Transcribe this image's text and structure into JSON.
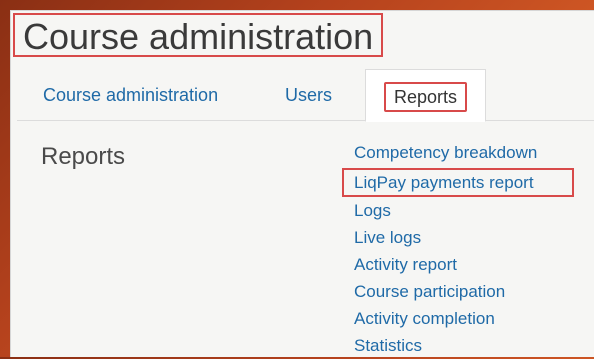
{
  "page": {
    "title": "Course administration"
  },
  "tabs": [
    {
      "label": "Course administration"
    },
    {
      "label": "Users"
    },
    {
      "label": "Reports",
      "active": true
    }
  ],
  "section": {
    "heading": "Reports",
    "links": [
      "Competency breakdown",
      "LiqPay payments report",
      "Logs",
      "Live logs",
      "Activity report",
      "Course participation",
      "Activity completion",
      "Statistics"
    ]
  },
  "colors": {
    "link": "#1f6aa7",
    "highlight_border": "#d84a4a",
    "background_accent": "#d35a25",
    "panel": "#f6f6f4"
  }
}
